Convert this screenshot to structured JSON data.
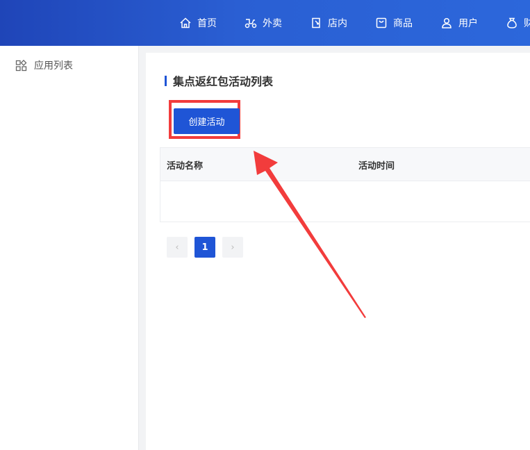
{
  "topnav": {
    "items": [
      {
        "label": "首页",
        "icon": "home-icon"
      },
      {
        "label": "外卖",
        "icon": "scooter-icon"
      },
      {
        "label": "店内",
        "icon": "store-door-icon"
      },
      {
        "label": "商品",
        "icon": "product-box-icon"
      },
      {
        "label": "用户",
        "icon": "user-icon"
      },
      {
        "label": "财",
        "icon": "money-bag-icon"
      }
    ]
  },
  "sidebar": {
    "items": [
      {
        "label": "应用列表",
        "icon": "apps-grid-icon"
      }
    ]
  },
  "page": {
    "title": "集点返红包活动列表",
    "create_button": "创建活动"
  },
  "table": {
    "columns": [
      "活动名称",
      "活动时间"
    ],
    "rows": []
  },
  "pagination": {
    "current": "1",
    "prev": "‹",
    "next": "›"
  },
  "colors": {
    "primary": "#1f55d6",
    "annotation": "#f23c3c"
  }
}
